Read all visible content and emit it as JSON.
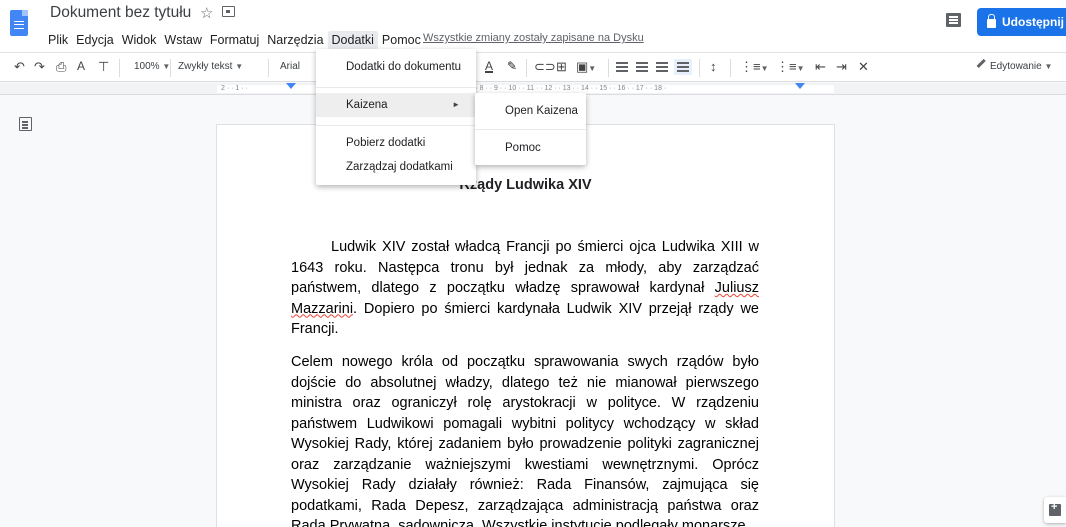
{
  "header": {
    "doc_title": "Dokument bez tytułu",
    "save_status": "Wszystkie zmiany zostały zapisane na Dysku",
    "share_label": "Udostępnij"
  },
  "menubar": [
    "Plik",
    "Edycja",
    "Widok",
    "Wstaw",
    "Formatuj",
    "Narzędzia",
    "Dodatki",
    "Pomoc"
  ],
  "menubar_active": "Dodatki",
  "toolbar": {
    "zoom": "100%",
    "style": "Zwykły tekst",
    "font": "Arial",
    "edit_mode": "Edytowanie"
  },
  "ruler": {
    "ticks_left": "2 · · 1 · ·",
    "ticks_right": "· 7 · · 8 · · 9 · · 10 · · 11 · · 12 · · 13 · · 14 · · 15 · · 16 · · 17 · · 18 ·"
  },
  "dodatki_menu": {
    "items": [
      "Dodatki do dokumentu",
      "Kaizena",
      "Pobierz dodatki",
      "Zarządzaj dodatkami"
    ]
  },
  "kaizena_submenu": {
    "items": [
      "Open Kaizena",
      "Pomoc"
    ]
  },
  "document": {
    "heading": "Rządy Ludwika XIV",
    "paragraph1_a": "Ludwik XIV został władcą Francji po śmierci ojca Ludwika XIII w 1643 roku. Następca tronu był jednak za młody, aby zarządzać państwem, dlatego z początku władzę sprawował kardynał ",
    "paragraph1_name1": "Juliusz",
    "paragraph1_name2": "Mazzarini",
    "paragraph1_b": ". Dopiero po śmierci kardynała Ludwik XIV przejął rządy we Francji.",
    "paragraph2": "Celem nowego króla od początku sprawowania swych rządów było dojście do absolutnej władzy, dlatego też nie mianował pierwszego ministra oraz ograniczył rolę arystokracji w polityce. W rządzeniu państwem Ludwikowi pomagali wybitni politycy wchodzący w skład Wysokiej Rady, której zadaniem było prowadzenie polityki zagranicznej oraz zarządzanie ważniejszymi kwestiami wewnętrznymi. Oprócz Wysokiej Rady działały również: Rada Finansów, zajmująca się podatkami, Rada Depesz, zarządzająca administracją państwa oraz Rada Prywatna, sądownicza. Wszystkie instytucje podlegały monarsze."
  },
  "colors": {
    "accent": "#1a73e8",
    "doc_icon": "#4285f4",
    "spell_error": "#ea4335"
  }
}
